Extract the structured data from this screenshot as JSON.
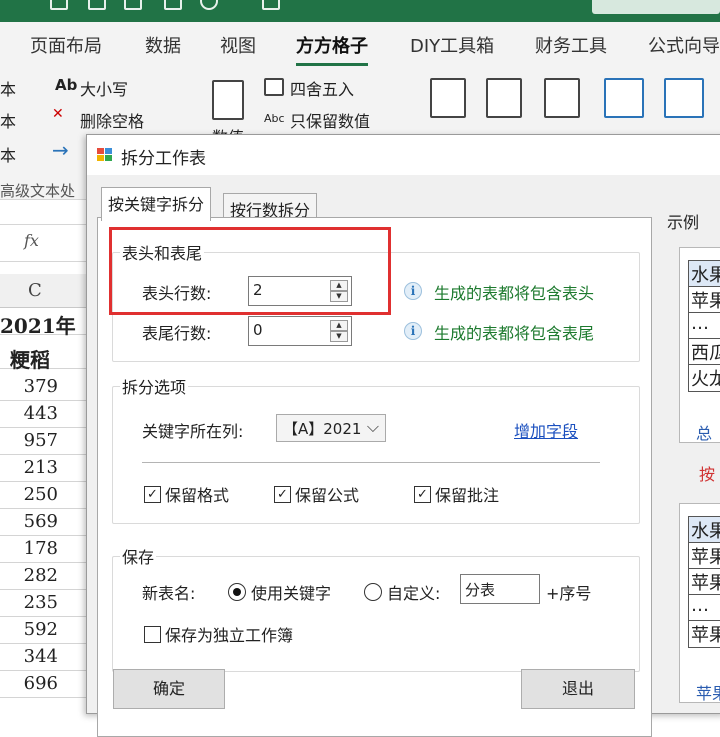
{
  "ribbon": {
    "tabs": [
      "页面布局",
      "数据",
      "视图",
      "方方格子",
      "DIY工具箱",
      "财务工具",
      "公式向导"
    ],
    "active_tab": "方方格子",
    "items": {
      "uppercase": "大小写",
      "remove_spaces": "删除空格",
      "round": "四舍五入",
      "keep_values": "只保留数值",
      "ab_glyph": "Ab",
      "abc_glyph": "Abc",
      "left_cut_1": "本",
      "left_cut_2": "本",
      "left_cut_3": "本",
      "group_cut": "高级文本处",
      "values_cut": "数值"
    },
    "accent_color": "#217346"
  },
  "sheet": {
    "formula_label": "fx",
    "column_letter": "C",
    "rows": [
      "2021年",
      "粳稻",
      "379",
      "443",
      "957",
      "213",
      "250",
      "569",
      "178",
      "282",
      "235",
      "592",
      "344",
      "696"
    ]
  },
  "dialog": {
    "title": "拆分工作表",
    "tabs": [
      "按关键字拆分",
      "按行数拆分"
    ],
    "active_tab": "按关键字拆分",
    "header_footer": {
      "group_label": "表头和表尾",
      "header_rows_label": "表头行数:",
      "header_rows_value": "2",
      "header_hint": "生成的表都将包含表头",
      "footer_rows_label": "表尾行数:",
      "footer_rows_value": "0",
      "footer_hint": "生成的表都将包含表尾"
    },
    "split_options": {
      "group_label": "拆分选项",
      "key_column_label": "关键字所在列:",
      "key_column_value": "【A】2021",
      "add_field_link": "增加字段",
      "keep_format": "保留格式",
      "keep_formula": "保留公式",
      "keep_comment": "保留批注",
      "keep_format_checked": true,
      "keep_formula_checked": true,
      "keep_comment_checked": true
    },
    "save": {
      "group_label": "保存",
      "sheet_name_label": "新表名:",
      "use_keyword": "使用关键字",
      "custom": "自定义:",
      "custom_value": "分表",
      "suffix": "+序号",
      "independent_workbook": "保存为独立工作簿",
      "selected_option": "使用关键字"
    },
    "buttons": {
      "ok": "确定",
      "exit": "退出"
    },
    "example": {
      "label": "示例",
      "table1": [
        "水果",
        "苹果",
        "…",
        "西瓜",
        "火龙"
      ],
      "bottom1": "总",
      "by_label": "按",
      "table2": [
        "水果",
        "苹果",
        "苹果",
        "…",
        "苹果"
      ],
      "bottom2": "苹果"
    },
    "highlight_color": "#e03030",
    "hint_color": "#1d7a2e"
  }
}
